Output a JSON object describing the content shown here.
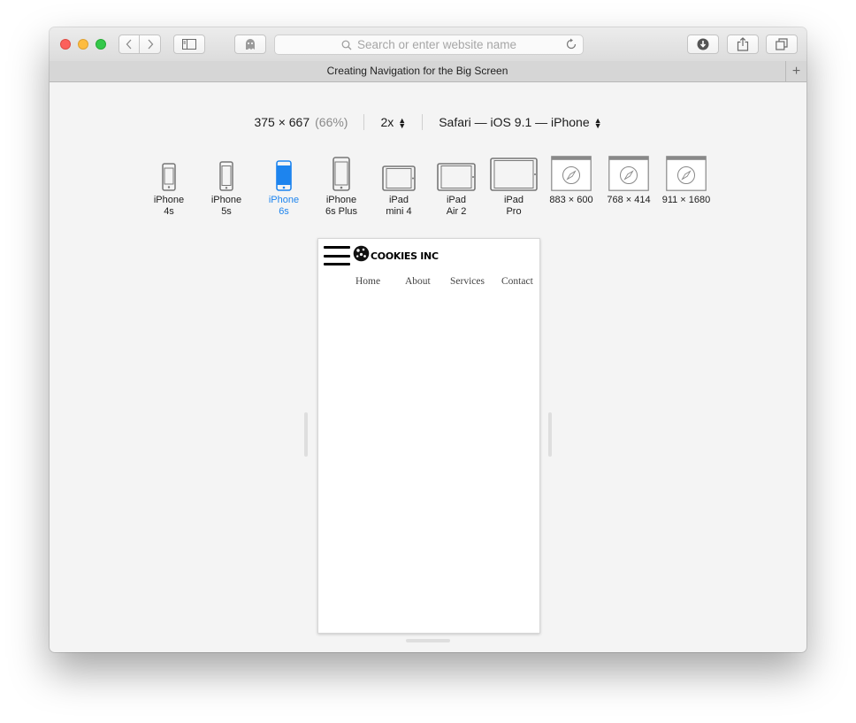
{
  "browser": {
    "address_placeholder": "Search or enter website name",
    "tab_title": "Creating Navigation for the Big Screen",
    "new_tab_label": "+"
  },
  "responsive_toolbar": {
    "dimensions": "375 × 667",
    "scale_percent": "(66%)",
    "pixel_ratio": "2x",
    "user_agent": "Safari — iOS 9.1 — iPhone"
  },
  "devices": [
    {
      "line1": "iPhone",
      "line2": "4s",
      "icon": "phone-icon",
      "selected": false
    },
    {
      "line1": "iPhone",
      "line2": "5s",
      "icon": "phone-icon",
      "selected": false
    },
    {
      "line1": "iPhone",
      "line2": "6s",
      "icon": "phone-icon",
      "selected": true
    },
    {
      "line1": "iPhone",
      "line2": "6s Plus",
      "icon": "phone-icon",
      "selected": false
    },
    {
      "line1": "iPad",
      "line2": "mini 4",
      "icon": "tablet-icon",
      "selected": false
    },
    {
      "line1": "iPad",
      "line2": "Air 2",
      "icon": "tablet-icon",
      "selected": false
    },
    {
      "line1": "iPad",
      "line2": "Pro",
      "icon": "tablet-icon",
      "selected": false
    },
    {
      "line1": "883 × 600",
      "line2": "",
      "icon": "safari-window-icon",
      "selected": false
    },
    {
      "line1": "768 × 414",
      "line2": "",
      "icon": "safari-window-icon",
      "selected": false
    },
    {
      "line1": "911 × 1680",
      "line2": "",
      "icon": "safari-window-icon",
      "selected": false
    }
  ],
  "site": {
    "brand": "COOKIES INC",
    "nav": [
      "Home",
      "About",
      "Services",
      "Contact"
    ]
  },
  "colors": {
    "selected_device": "#1d84ee",
    "close": "#fc605c",
    "minimize": "#fdbc40",
    "zoom": "#34c84a"
  }
}
